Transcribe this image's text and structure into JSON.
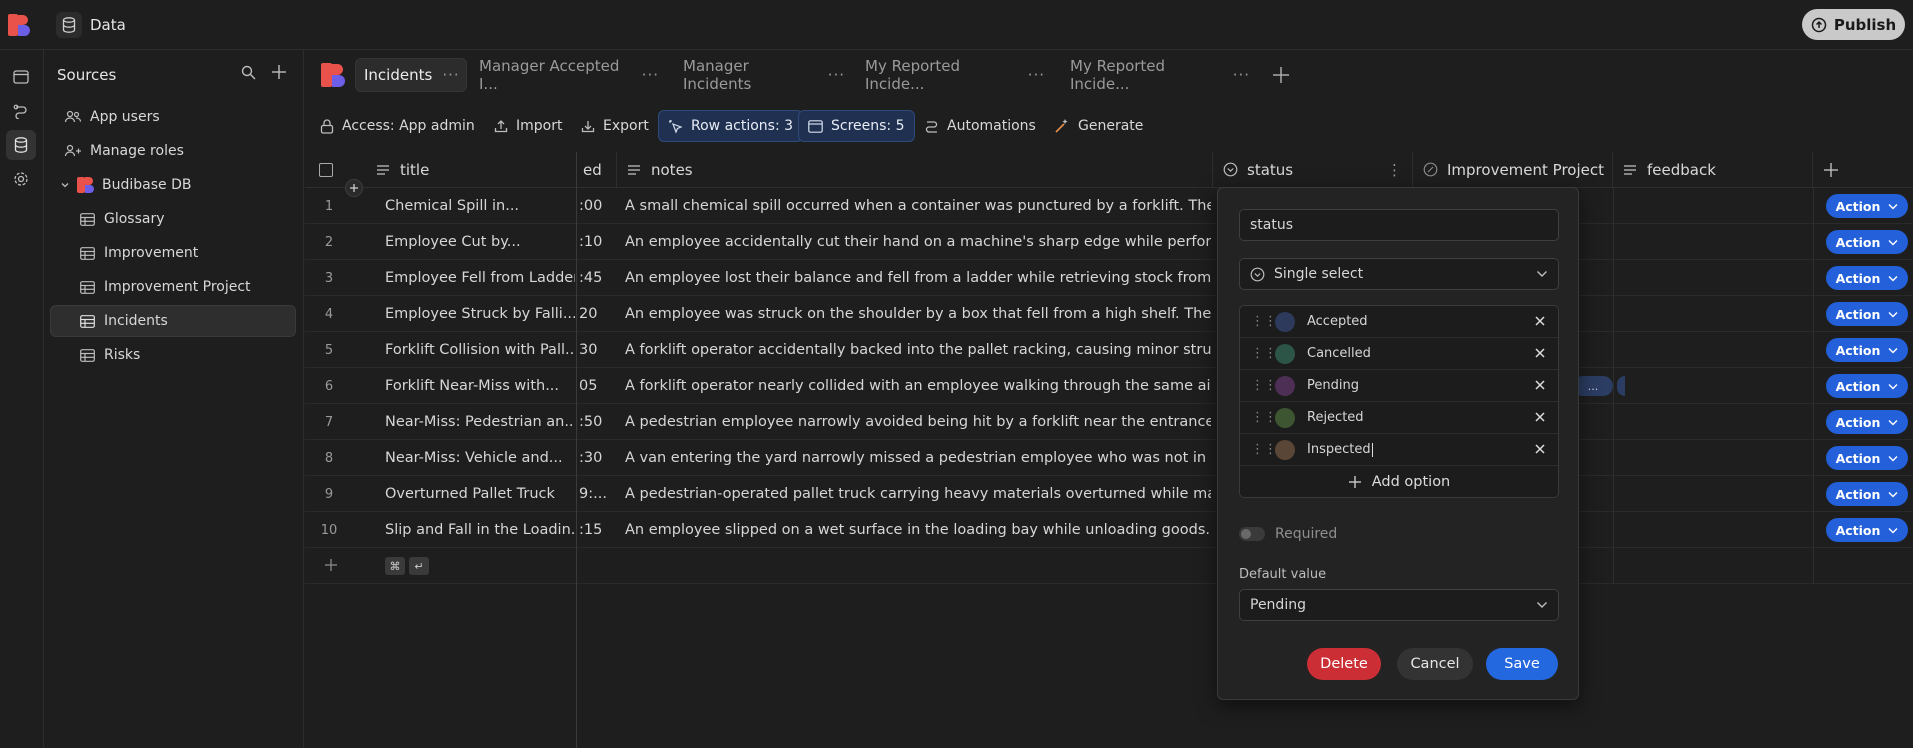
{
  "app": {
    "title": "Data",
    "publish_label": "Publish"
  },
  "sources": {
    "title": "Sources",
    "items": [
      {
        "label": "App users",
        "icon": "users-icon"
      },
      {
        "label": "Manage roles",
        "icon": "user-roles-icon"
      },
      {
        "label": "Budibase DB",
        "icon": "budibase-logo"
      },
      {
        "label": "Glossary",
        "icon": "table-icon"
      },
      {
        "label": "Improvement",
        "icon": "table-icon"
      },
      {
        "label": "Improvement Project",
        "icon": "table-icon"
      },
      {
        "label": "Incidents",
        "icon": "table-icon"
      },
      {
        "label": "Risks",
        "icon": "table-icon"
      }
    ]
  },
  "tabs": [
    {
      "label": "Incidents",
      "dots": "···"
    },
    {
      "label": "Manager Accepted I...",
      "dots": "···"
    },
    {
      "label": "Manager Incidents",
      "dots": "···"
    },
    {
      "label": "My Reported Incide...",
      "dots": "···"
    },
    {
      "label": "My Reported Incide...",
      "dots": "···"
    }
  ],
  "toolbar": {
    "access": "Access: App admin",
    "import": "Import",
    "export": "Export",
    "row_actions": "Row actions: 3",
    "screens": "Screens: 5",
    "automations": "Automations",
    "generate": "Generate"
  },
  "columns": {
    "title": "title",
    "date_partial": "ed",
    "notes": "notes",
    "status": "status",
    "improvement_project": "Improvement Project",
    "feedback": "feedback"
  },
  "rows": [
    {
      "num": "1",
      "title": "Chemical Spill in...",
      "time": ":00",
      "notes": "A small chemical spill occurred when a container was punctured by a forklift. The spill...",
      "action": "Action"
    },
    {
      "num": "2",
      "title": "Employee Cut by...",
      "time": ":10",
      "notes": "An employee accidentally cut their hand on a machine's sharp edge while performing...",
      "action": "Action"
    },
    {
      "num": "3",
      "title": "Employee Fell from Ladder",
      "time": ":45",
      "notes": "An employee lost their balance and fell from a ladder while retrieving stock from a hig...",
      "action": "Action"
    },
    {
      "num": "4",
      "title": "Employee Struck by Falli...",
      "time": "20",
      "notes": "An employee was struck on the shoulder by a box that fell from a high shelf. The...",
      "action": "Action"
    },
    {
      "num": "5",
      "title": "Forklift Collision with Pall...",
      "time": "30",
      "notes": "A forklift operator accidentally backed into the pallet racking, causing minor structural...",
      "action": "Action"
    },
    {
      "num": "6",
      "title": "Forklift Near-Miss with...",
      "time": "05",
      "notes": "A forklift operator nearly collided with an employee walking through the same aisle....",
      "action": "Action"
    },
    {
      "num": "7",
      "title": "Near-Miss: Pedestrian an...",
      "time": ":50",
      "notes": "A pedestrian employee narrowly avoided being hit by a forklift near the entrance to th...",
      "action": "Action"
    },
    {
      "num": "8",
      "title": "Near-Miss: Vehicle and...",
      "time": ":30",
      "notes": "A van entering the yard narrowly missed a pedestrian employee who was not in a...",
      "action": "Action"
    },
    {
      "num": "9",
      "title": "Overturned Pallet Truck",
      "time": "9:...",
      "notes": "A pedestrian-operated pallet truck carrying heavy materials overturned while making ...",
      "action": "Action"
    },
    {
      "num": "10",
      "title": "Slip and Fall in the Loadin...",
      "time": ":15",
      "notes": "An employee slipped on a wet surface in the loading bay while unloading goods. The...",
      "action": "Action"
    }
  ],
  "footer": {
    "cmd_key": "⌘",
    "enter_key": "↵"
  },
  "popover": {
    "name_value": "status",
    "type_value": "Single select",
    "options": [
      {
        "label": "Accepted",
        "color": "#2e3a5c"
      },
      {
        "label": "Cancelled",
        "color": "#2c5548"
      },
      {
        "label": "Pending",
        "color": "#4d2f55"
      },
      {
        "label": "Rejected",
        "color": "#3d5530"
      },
      {
        "label": "Inspected",
        "color": "#5a4636"
      }
    ],
    "add_option": "Add option",
    "required_label": "Required",
    "default_label": "Default value",
    "default_value": "Pending",
    "delete_label": "Delete",
    "cancel_label": "Cancel",
    "save_label": "Save"
  },
  "peek_cell": "...",
  "colors": {
    "action_blue": "#2360d9",
    "delete_red": "#cc2e35",
    "save_blue": "#2468e0"
  }
}
